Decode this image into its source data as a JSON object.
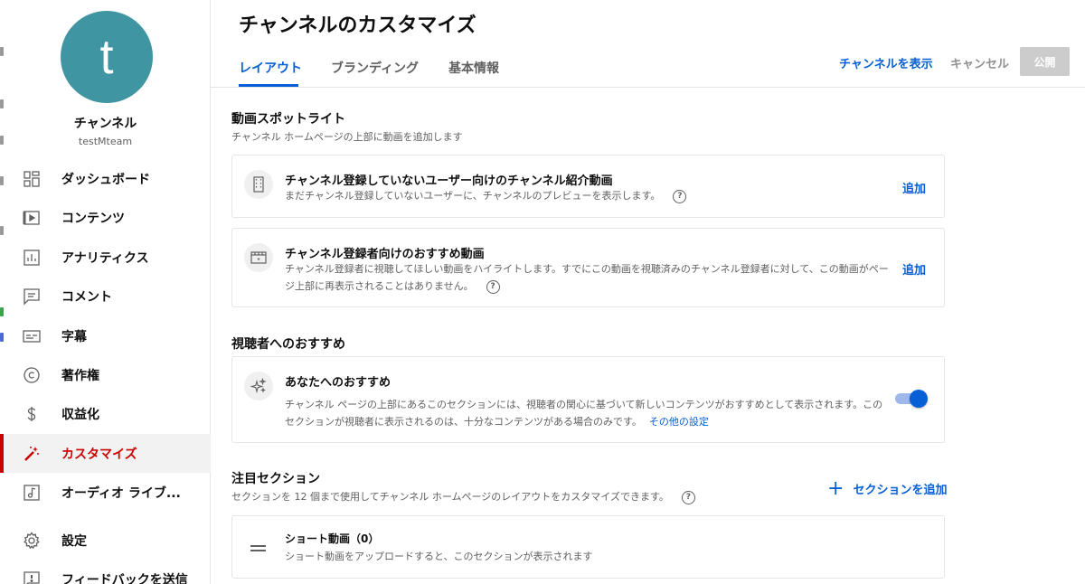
{
  "sidebar": {
    "avatar_letter": "t",
    "avatar_color": "#3f96a2",
    "channel_name": "チャンネル",
    "channel_handle": "testMteam",
    "items": [
      {
        "label": "ダッシュボード",
        "icon": "dashboard-icon"
      },
      {
        "label": "コンテンツ",
        "icon": "content-icon"
      },
      {
        "label": "アナリティクス",
        "icon": "analytics-icon"
      },
      {
        "label": "コメント",
        "icon": "comment-icon"
      },
      {
        "label": "字幕",
        "icon": "subtitles-icon"
      },
      {
        "label": "著作権",
        "icon": "copyright-icon"
      },
      {
        "label": "収益化",
        "icon": "dollar-icon"
      },
      {
        "label": "カスタマイズ",
        "icon": "magic-wand-icon",
        "active": true
      },
      {
        "label": "オーディオ ライブ...",
        "icon": "audio-library-icon"
      },
      {
        "label": "設定",
        "icon": "gear-icon"
      },
      {
        "label": "フィードバックを送信",
        "icon": "feedback-icon"
      }
    ]
  },
  "header": {
    "title": "チャンネルのカスタマイズ",
    "tabs": [
      {
        "label": "レイアウト",
        "active": true
      },
      {
        "label": "ブランディング"
      },
      {
        "label": "基本情報"
      }
    ],
    "view_channel": "チャンネルを表示",
    "cancel": "キャンセル",
    "publish": "公開"
  },
  "spotlight": {
    "title": "動画スポットライト",
    "description": "チャンネル ホームページの上部に動画を追加します",
    "cards": [
      {
        "title": "チャンネル登録していないユーザー向けのチャンネル紹介動画",
        "description": "まだチャンネル登録していないユーザーに、チャンネルのプレビューを表示します。",
        "action": "追加"
      },
      {
        "title": "チャンネル登録者向けのおすすめ動画",
        "description": "チャンネル登録者に視聴してほしい動画をハイライトします。すでにこの動画を視聴済みのチャンネル登録者に対して、この動画がページ上部に再表示されることはありません。",
        "action": "追加"
      }
    ]
  },
  "recommendations": {
    "title": "視聴者へのおすすめ",
    "card": {
      "title": "あなたへのおすすめ",
      "description": "チャンネル ページの上部にあるこのセクションには、視聴者の関心に基づいて新しいコンテンツがおすすめとして表示されます。このセクションが視聴者に表示されるのは、十分なコンテンツがある場合のみです。",
      "more_link": "その他の設定",
      "toggle_on": true
    }
  },
  "featured": {
    "title": "注目セクション",
    "description": "セクションを 12 個まで使用してチャンネル ホームページのレイアウトをカスタマイズできます。",
    "add_section": "セクションを追加",
    "card": {
      "title": "ショート動画（0）",
      "description": "ショート動画をアップロードすると、このセクションが表示されます"
    }
  },
  "help_glyph": "?",
  "colors": {
    "accent": "#065fd4",
    "active_nav": "#cc0000"
  }
}
